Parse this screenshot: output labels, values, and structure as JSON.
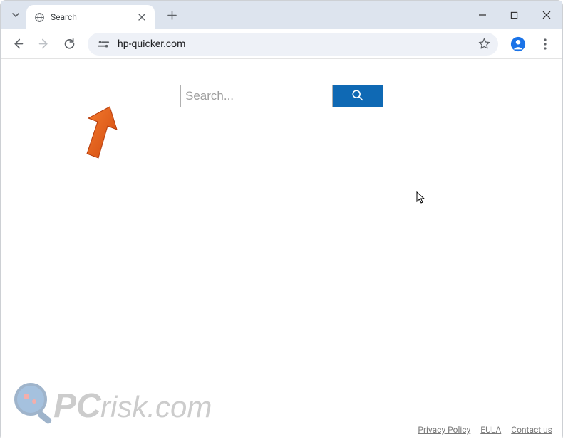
{
  "tab": {
    "title": "Search"
  },
  "omnibox": {
    "url": "hp-quicker.com"
  },
  "search": {
    "placeholder": "Search..."
  },
  "footer": {
    "links": [
      "Privacy Policy",
      "EULA",
      "Contact us"
    ]
  },
  "watermark": {
    "text": "PCrisk.com"
  },
  "colors": {
    "arrow": "#e35a1c",
    "search_button": "#0f69b4",
    "titlebar": "#dde4ee"
  }
}
